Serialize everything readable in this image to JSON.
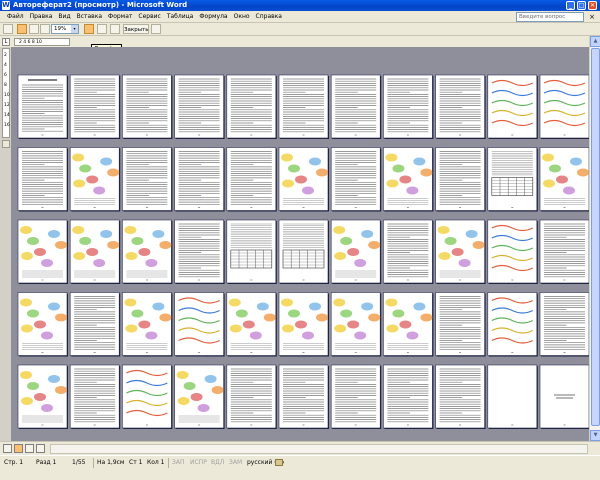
{
  "window": {
    "title": "Автореферат2 (просмотр) - Microsoft Word",
    "icon": "word-icon",
    "controls": {
      "minimize": "_",
      "maximize": "□",
      "close": "✕"
    }
  },
  "menu": {
    "items": [
      "Файл",
      "Правка",
      "Вид",
      "Вставка",
      "Формат",
      "Сервис",
      "Таблица",
      "Формула",
      "Окно",
      "Справка"
    ],
    "ask_placeholder": "Введите вопрос",
    "close_doc": "×"
  },
  "toolbar": {
    "zoom_value": "19%",
    "zoom_arrow": "▾",
    "close_label": "Закрыть",
    "tooltip": "Линейка",
    "pages_per_row_label": "2 4 6 8 10",
    "ruler_corner": "L"
  },
  "vruler_numbers": [
    "2",
    "4",
    "6",
    "8",
    "10",
    "12",
    "14",
    "16"
  ],
  "preview": {
    "page_count": 55,
    "rows": 5,
    "columns": 11,
    "page_kinds": [
      "title",
      "text",
      "text",
      "text",
      "text",
      "text",
      "text",
      "text",
      "text",
      "figure",
      "figure",
      "text",
      "map",
      "text",
      "text",
      "text",
      "map",
      "text",
      "map",
      "text",
      "table",
      "map",
      "map",
      "map",
      "map",
      "text",
      "table",
      "table",
      "map",
      "text",
      "map",
      "figure",
      "text",
      "map",
      "text",
      "map",
      "figure",
      "map",
      "map",
      "map",
      "map",
      "text",
      "figure",
      "text",
      "map",
      "text",
      "figure",
      "map",
      "text",
      "text",
      "text",
      "text",
      "text",
      "empty",
      "final"
    ]
  },
  "scroll": {
    "up": "▲",
    "down": "▼"
  },
  "statusbar": {
    "page": "Стр. 1",
    "section": "Разд 1",
    "pages": "1/55",
    "position": "На 1,9см",
    "line": "Ст 1",
    "column": "Кол 1",
    "rec": "ЗАП",
    "trk": "ИСПР",
    "ext": "ВДЛ",
    "ovr": "ЗАМ",
    "language": "русский (Ро"
  },
  "colors": {
    "titlebar": "#0a5ce8",
    "page_area": "#8f8f9c",
    "chrome": "#ece9d8"
  }
}
